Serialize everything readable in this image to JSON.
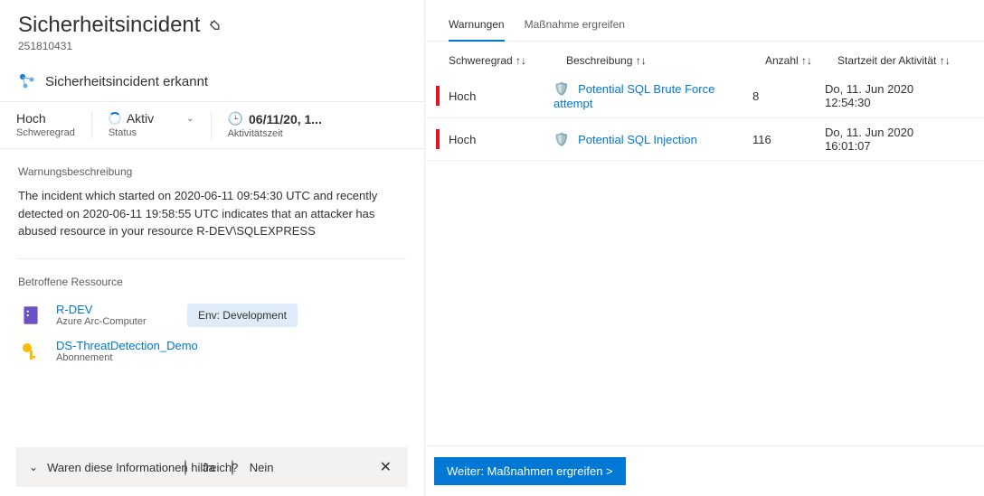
{
  "header": {
    "title": "Sicherheitsincident",
    "id": "251810431"
  },
  "incident_label": "Sicherheitsincident erkannt",
  "stats": {
    "severity_value": "Hoch",
    "severity_label": "Schweregrad",
    "status_value": "Aktiv",
    "status_label": "Status",
    "time_value": "06/11/20, 1...",
    "time_label": "Aktivitätszeit"
  },
  "description": {
    "title": "Warnungsbeschreibung",
    "text": "The incident which started on 2020-06-11 09:54:30 UTC and recently detected on 2020-06-11 19:58:55 UTC indicates that an attacker has abused resource in your resource R-DEV\\SQLEXPRESS"
  },
  "resources": {
    "title": "Betroffene Ressource",
    "items": [
      {
        "name": "R-DEV",
        "sub": "Azure Arc-Computer",
        "tag": "Env: Development"
      },
      {
        "name": "DS-ThreatDetection_Demo",
        "sub": "Abonnement",
        "tag": ""
      }
    ]
  },
  "feedback": {
    "text": "Waren diese Informationen hilfreich?",
    "yes": "Ja",
    "no": "Nein"
  },
  "tabs": {
    "alerts": "Warnungen",
    "action": "Maßnahme ergreifen"
  },
  "table": {
    "columns": {
      "severity": "Schweregrad ↑↓",
      "description": "Beschreibung ↑↓",
      "count": "Anzahl ↑↓",
      "start": "Startzeit der Aktivität ↑↓"
    },
    "rows": [
      {
        "severity": "Hoch",
        "description": "Potential SQL Brute Force attempt",
        "count": "8",
        "start": "Do, 11. Jun 2020 12:54:30"
      },
      {
        "severity": "Hoch",
        "description": "Potential SQL Injection",
        "count": "116",
        "start": "Do, 11. Jun 2020 16:01:07"
      }
    ]
  },
  "footer": {
    "next": "Weiter: Maßnahmen ergreifen >"
  }
}
